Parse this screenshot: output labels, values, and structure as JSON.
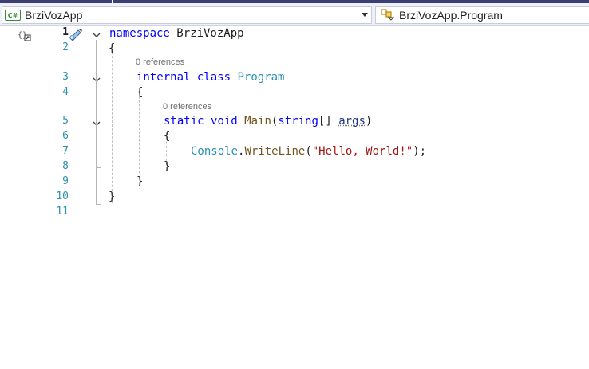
{
  "navigation": {
    "project_dropdown": {
      "language_badge": "C#",
      "label": "BrziVozApp"
    },
    "type_dropdown": {
      "label": "BrziVozApp.Program"
    }
  },
  "editor": {
    "active_line": 1,
    "line_numbers": [
      "1",
      "2",
      "3",
      "4",
      "5",
      "6",
      "7",
      "8",
      "9",
      "10",
      "11"
    ],
    "codelens": {
      "class_references": "0 references",
      "method_references": "0 references"
    },
    "code": {
      "l1_kw": "namespace",
      "l1_name": " BrziVozApp",
      "l2": "{",
      "l3_kw1": "internal",
      "l3_kw2": "class",
      "l3_type": "Program",
      "l4": "{",
      "l5_kw1": "static",
      "l5_kw2": "void",
      "l5_fn": "Main",
      "l5_open": "(",
      "l5_kw3": "string",
      "l5_arr": "[] ",
      "l5_param": "args",
      "l5_close": ")",
      "l6": "{",
      "l7_type": "Console",
      "l7_dot": ".",
      "l7_fn": "WriteLine",
      "l7_open": "(",
      "l7_str": "\"Hello, World!\"",
      "l7_close": ");",
      "l8": "}",
      "l9": "}",
      "l10": "}"
    }
  },
  "colors": {
    "keyword": "#0000ff",
    "type": "#2b91af",
    "method": "#74531f",
    "string": "#a31515",
    "parameter": "#1f377f",
    "line_number": "#2b91af"
  },
  "icons": {
    "language": "csharp-icon",
    "class_member": "class-member-icon",
    "scope": "scope-braces-icon",
    "quick_action": "pencil-brush-icon"
  }
}
